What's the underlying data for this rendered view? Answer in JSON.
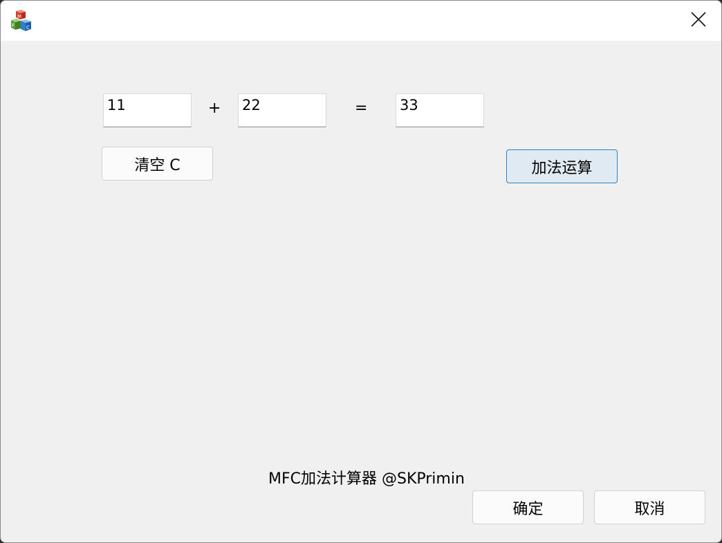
{
  "window": {
    "title": "",
    "icon": "mfc-app-icon",
    "close_icon": "close-icon"
  },
  "calculator": {
    "operand1": "11",
    "plus_sign": "+",
    "operand2": "22",
    "equals_sign": "=",
    "result": "33"
  },
  "buttons": {
    "clear_label": "清空 C",
    "add_label": "加法运算",
    "ok_label": "确定",
    "cancel_label": "取消"
  },
  "footer": {
    "caption": "MFC加法计算器 @SKPrimin"
  },
  "colors": {
    "dialog_bg": "#f0f0f0",
    "default_button_border": "#2f7fbe",
    "default_button_bg": "#e0eaf3"
  }
}
